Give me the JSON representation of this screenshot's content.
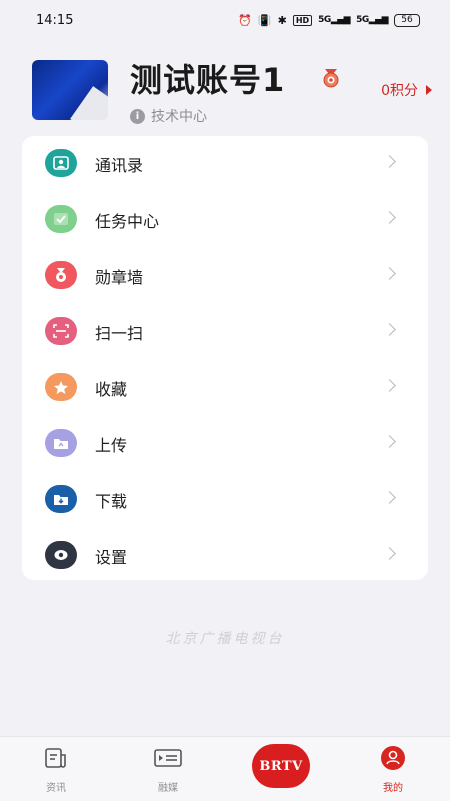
{
  "status_bar": {
    "time": "14:15",
    "hd": "HD",
    "signal1": "5G",
    "signal2": "5G",
    "battery": "56"
  },
  "profile": {
    "name": "测试账号1",
    "department": "技术中心",
    "points": "0积分"
  },
  "menu": [
    {
      "label": "通讯录",
      "icon": "contacts-icon",
      "color": "#1fa39a"
    },
    {
      "label": "任务中心",
      "icon": "task-icon",
      "color": "#7fd08c"
    },
    {
      "label": "勋章墙",
      "icon": "medal-icon",
      "color": "#f0575e"
    },
    {
      "label": "扫一扫",
      "icon": "scan-icon",
      "color": "#e5607e"
    },
    {
      "label": "收藏",
      "icon": "star-icon",
      "color": "#f59a5f"
    },
    {
      "label": "上传",
      "icon": "upload-icon",
      "color": "#a6a1e3"
    },
    {
      "label": "下载",
      "icon": "download-icon",
      "color": "#1a5fa8"
    },
    {
      "label": "设置",
      "icon": "settings-icon",
      "color": "#2f3542"
    }
  ],
  "watermark": "北京广播电视台",
  "bottom_nav": {
    "items": [
      {
        "label": "资讯",
        "icon": "news-icon"
      },
      {
        "label": "融媒",
        "icon": "media-icon"
      },
      {
        "label": "BRTV",
        "icon": "brtv-logo"
      },
      {
        "label": "我的",
        "icon": "profile-icon"
      }
    ]
  },
  "colors": {
    "accent": "#d6261f",
    "background": "#f2f2f6"
  }
}
